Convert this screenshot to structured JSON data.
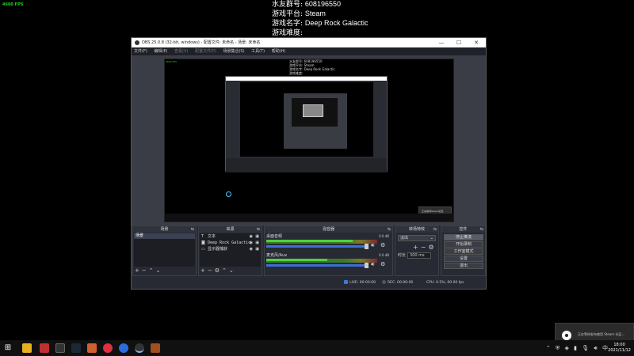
{
  "fps_counter": "4660 FPS",
  "overlay": {
    "rows": [
      {
        "label": "水友群号:",
        "value": "608196550"
      },
      {
        "label": "游戏平台:",
        "value": "Steam"
      },
      {
        "label": "游戏名字:",
        "value": "Deep Rock Galactic"
      },
      {
        "label": "游戏难度:",
        "value": ""
      }
    ]
  },
  "obs": {
    "title": "OBS 25.0.8 (32-bit, windows) - 配置文件: 未命名 - 场景: 未命名",
    "window_buttons": {
      "minimize": "—",
      "maximize": "☐",
      "close": "✕"
    },
    "menu": [
      {
        "label": "文件(F)",
        "disabled": false
      },
      {
        "label": "编辑(E)",
        "disabled": false
      },
      {
        "label": "查看(V)",
        "disabled": true
      },
      {
        "label": "配置文件(P)",
        "disabled": true
      },
      {
        "label": "场景集合(S)",
        "disabled": false
      },
      {
        "label": "工具(T)",
        "disabled": false
      },
      {
        "label": "帮助(H)",
        "disabled": false
      }
    ],
    "preview": {
      "inner_fps": "4660 FPS",
      "inner_overlay": [
        "水友群号:   608196550",
        "游戏平台:   Steam",
        "游戏名字:   Deep Rock Galactic",
        "游戏难度:"
      ],
      "inner_notif": "正在等待Steam社区"
    },
    "docks": {
      "scenes": {
        "title": "场景",
        "items": [
          "场景"
        ]
      },
      "sources": {
        "title": "来源",
        "items": [
          {
            "icon": "text-icon",
            "label": "文本"
          },
          {
            "icon": "game-capture-icon",
            "label": "Deep Rock Galactic"
          },
          {
            "icon": "display-capture-icon",
            "label": "显示器捕获"
          }
        ]
      },
      "mixer": {
        "title": "混音器",
        "channels": [
          {
            "name": "桌面音频",
            "db": "0.0 dB",
            "level": 0.78
          },
          {
            "name": "麦克风/Aux",
            "db": "0.0 dB",
            "level": 0.55
          }
        ]
      },
      "transitions": {
        "title": "转场特效",
        "selected": "淡出",
        "duration_label": "时长",
        "duration_value": "300 ms"
      },
      "controls": {
        "title": "控件",
        "buttons": [
          {
            "label": "停止推流",
            "active": true
          },
          {
            "label": "开始录制",
            "active": false
          },
          {
            "label": "工作室模式",
            "active": false
          },
          {
            "label": "设置",
            "active": false
          },
          {
            "label": "退出",
            "active": false
          }
        ]
      }
    },
    "status": {
      "live_label": "LIVE:",
      "live_time": "00:00:00",
      "rec_label": "REC:",
      "rec_time": "00:00:00",
      "cpu": "CPU: 0.5%, 60.00 fps"
    }
  },
  "steam_notification": "正在等待发布使用 Steam 社区...",
  "taskbar": {
    "clock_time": "18:00",
    "clock_date": "2021/11/12",
    "tray_lang": "中"
  },
  "colors": {
    "fps_green": "#18d818",
    "obs_bg": "#272a33",
    "accent_blue": "#3d6fd8",
    "meter_green": "#4fd23c"
  }
}
